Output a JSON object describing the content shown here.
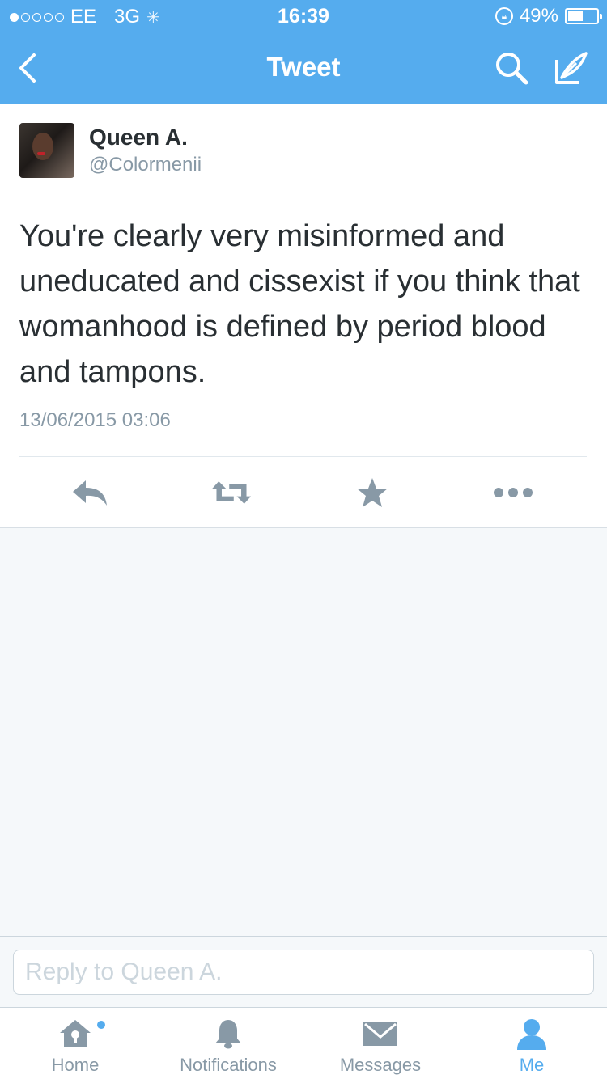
{
  "status_bar": {
    "carrier": "EE",
    "network": "3G",
    "time": "16:39",
    "battery": "49%",
    "battery_level": 0.49,
    "signal_bars_filled": 1,
    "signal_bars_total": 5
  },
  "nav": {
    "title": "Tweet",
    "back_icon": "chevron-left-icon",
    "search_icon": "search-icon",
    "compose_icon": "compose-icon"
  },
  "tweet": {
    "name": "Queen A.",
    "handle": "@Colormenii",
    "text": "You're clearly very misinformed and uneducated and cissexist if you think that womanhood is defined by period blood and tampons.",
    "timestamp": "13/06/2015 03:06",
    "actions": [
      "reply-icon",
      "retweet-icon",
      "favorite-icon",
      "more-icon"
    ]
  },
  "reply": {
    "placeholder": "Reply to Queen A."
  },
  "tabs": [
    {
      "label": "Home",
      "icon": "home-icon",
      "active": false,
      "has_notification_dot": true
    },
    {
      "label": "Notifications",
      "icon": "bell-icon",
      "active": false
    },
    {
      "label": "Messages",
      "icon": "envelope-icon",
      "active": false
    },
    {
      "label": "Me",
      "icon": "person-icon",
      "active": true
    }
  ],
  "colors": {
    "brand_blue": "#55acee",
    "text_dark": "#292f33",
    "text_gray": "#8899a6",
    "icon_gray": "#8899a6",
    "background": "#f5f8fa"
  }
}
